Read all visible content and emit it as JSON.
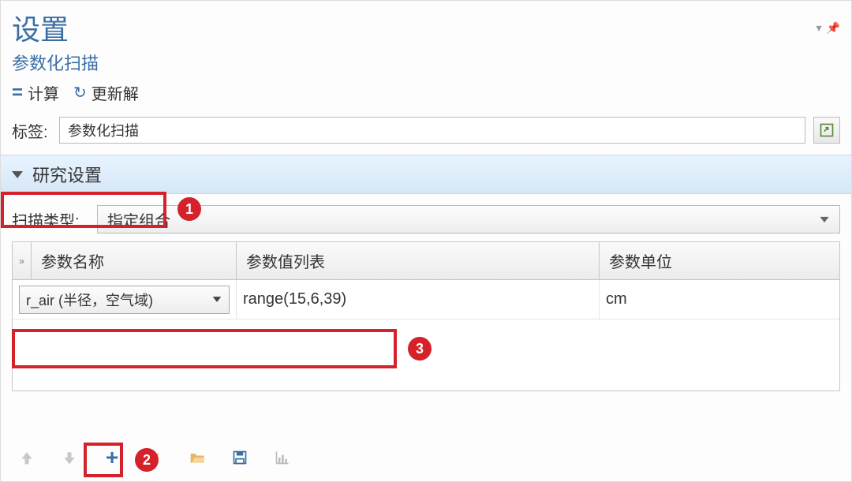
{
  "header": {
    "title": "设置",
    "subtitle": "参数化扫描",
    "actions": {
      "compute_label": "计算",
      "update_label": "更新解"
    }
  },
  "label_row": {
    "caption": "标签:",
    "value": "参数化扫描"
  },
  "section": {
    "title": "研究设置"
  },
  "scan": {
    "caption": "扫描类型:",
    "combo_value": "指定组合"
  },
  "table": {
    "headers": {
      "col1": "参数名称",
      "col2": "参数值列表",
      "col3": "参数单位"
    },
    "row0": {
      "param_name": "r_air (半径，空气域)",
      "values": "range(15,6,39)",
      "unit": "cm"
    }
  },
  "callouts": {
    "n1": "1",
    "n2": "2",
    "n3": "3"
  }
}
